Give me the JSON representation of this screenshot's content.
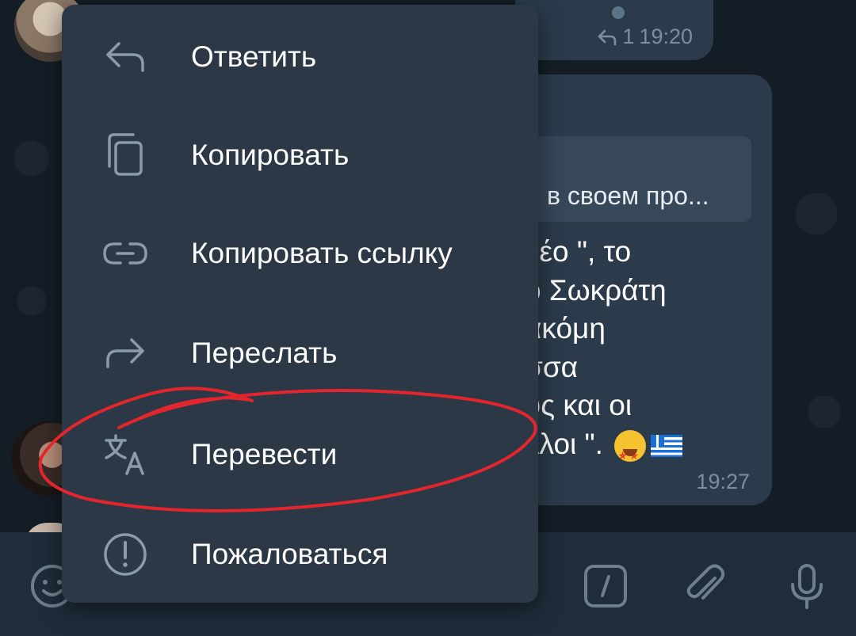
{
  "menu": {
    "items": [
      {
        "label": "Ответить",
        "icon": "reply-icon"
      },
      {
        "label": "Копировать",
        "icon": "copy-icon"
      },
      {
        "label": "Копировать ссылку",
        "icon": "link-icon"
      },
      {
        "label": "Переслать",
        "icon": "forward-icon"
      },
      {
        "label": "Перевести",
        "icon": "translate-icon"
      },
      {
        "label": "Пожаловаться",
        "icon": "report-icon"
      }
    ]
  },
  "messages": {
    "top": {
      "reply_count": "1",
      "time": "19:20"
    },
    "main": {
      "reply_preview": "в своем про...",
      "text_lines": [
        "νέο \", το",
        "ο Σωκράτη",
        "ακόμη",
        "σσα",
        "υς και οι",
        "λλοι \". "
      ],
      "time": "19:27"
    }
  },
  "colors": {
    "background": "#17212b",
    "menu": "#2c3846",
    "bubble": "#2b3b4b",
    "annotation": "#e3262d",
    "icon": "#8a9bab"
  },
  "input_bar": {
    "icons": [
      "emoji-icon",
      "bot-command-icon",
      "attach-icon",
      "microphone-icon"
    ]
  }
}
